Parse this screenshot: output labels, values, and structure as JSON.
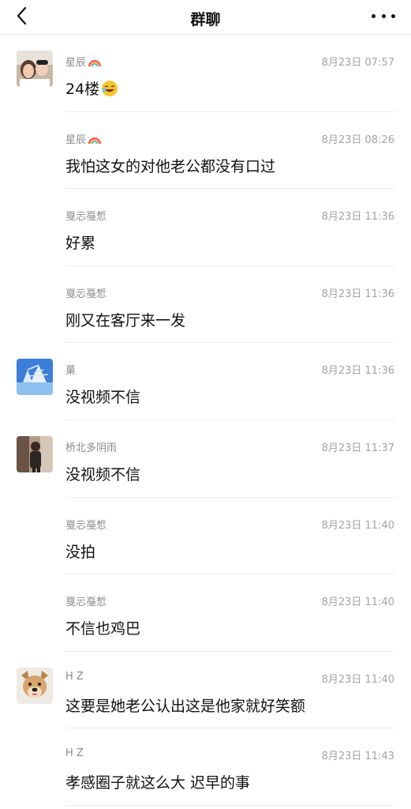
{
  "nav": {
    "title": "群聊"
  },
  "messages": [
    {
      "name": "星辰",
      "name_icon": "rainbow-icon",
      "time": "8月23日 07:57",
      "text": "24楼",
      "text_icon": "laughing-emoji",
      "avatar": "couple-photo"
    },
    {
      "name": "星辰",
      "name_icon": "rainbow-icon",
      "time": "8月23日 08:26",
      "text": "我怕这女的对他老公都没有口过",
      "avatar": ""
    },
    {
      "name": "戛忈戞惁",
      "time": "8月23日 11:36",
      "text": "好累",
      "avatar": ""
    },
    {
      "name": "戛忈戞惁",
      "time": "8月23日 11:36",
      "text": "刚又在客厅来一发",
      "avatar": ""
    },
    {
      "name": "菓",
      "time": "8月23日 11:36",
      "text": "没视频不信",
      "avatar": "snow-tree-photo"
    },
    {
      "name": "桥北多阴雨",
      "time": "8月23日 11:37",
      "text": "没视频不信",
      "avatar": "person-photo"
    },
    {
      "name": "戛忈戞惁",
      "time": "8月23日 11:40",
      "text": "没拍",
      "avatar": ""
    },
    {
      "name": "戛忈戞惁",
      "time": "8月23日 11:40",
      "text": "不信也鸡巴",
      "avatar": ""
    },
    {
      "name": "H Z",
      "time": "8月23日 11:40",
      "text": "这要是她老公认出这是他家就好笑额",
      "avatar": "dog-photo"
    },
    {
      "name": "H Z",
      "time": "8月23日 11:43",
      "text": "孝感圈子就这么大 迟早的事",
      "avatar": ""
    }
  ]
}
